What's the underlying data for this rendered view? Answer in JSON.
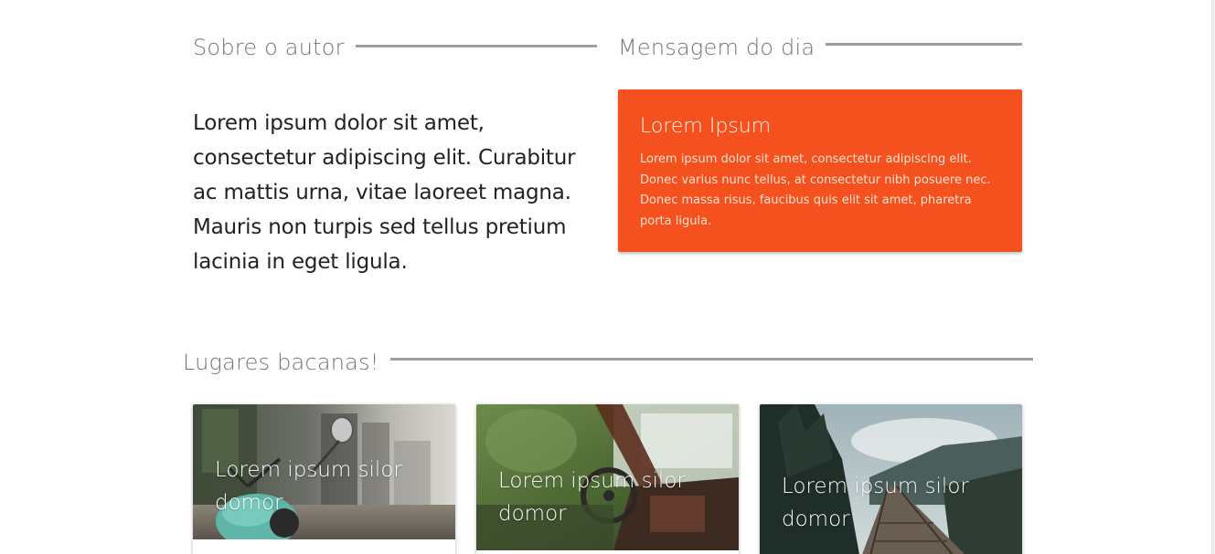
{
  "author_section": {
    "heading": "Sobre o autor",
    "text": "Lorem ipsum dolor sit amet, consectetur adipiscing elit. Curabitur ac mattis urna, vitae laoreet magna. Mauris non turpis sed tellus pretium lacinia in eget ligula."
  },
  "message_section": {
    "heading": "Mensagem do dia",
    "card": {
      "title": "Lorem Ipsum",
      "text": "Lorem ipsum dolor sit amet, consectetur adipiscing elit. Donec varius nunc tellus, at consectetur nibh posuere nec. Donec massa risus, faucibus quis elit sit amet, pharetra porta ligula.",
      "color": "#f4511e"
    }
  },
  "places_section": {
    "heading": "Lugares bacanas!",
    "cards": [
      {
        "caption": "Lorem ipsum silor domor",
        "image": "scooter-street-photo"
      },
      {
        "caption": "Lorem ipsum silor domor",
        "image": "abandoned-car-interior-photo"
      },
      {
        "caption": "Lorem ipsum silor domor",
        "image": "forest-railway-bridge-photo"
      }
    ]
  }
}
